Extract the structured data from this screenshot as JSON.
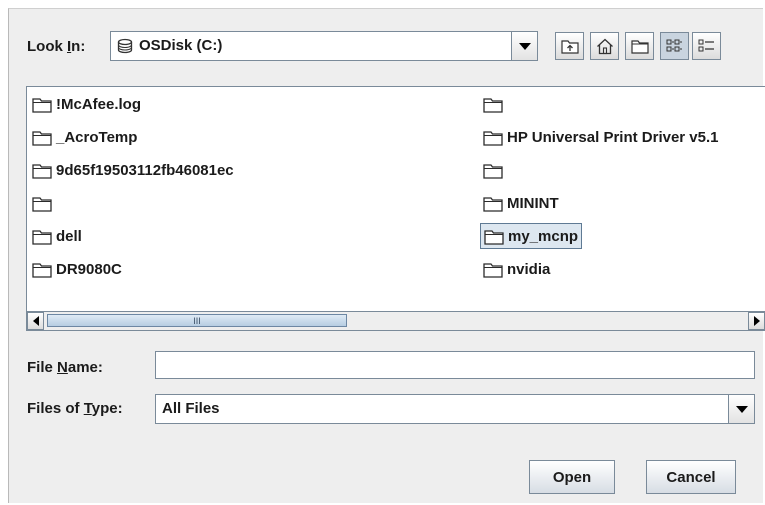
{
  "look_in": {
    "label_pre": "Look ",
    "label_mnemonic": "I",
    "label_post": "n:",
    "value": "OSDisk (C:)",
    "icon": "drive-icon"
  },
  "toolbar": {
    "up_one_level": "folder-up-icon",
    "home": "home-icon",
    "new_folder": "new-folder-icon",
    "list_view": "list-view-icon",
    "details_view": "details-view-icon"
  },
  "files": {
    "left_column": [
      {
        "name": "!McAfee.log"
      },
      {
        "name": "_AcroTemp"
      },
      {
        "name": "9d65f19503112fb46081ec"
      },
      {
        "name": ""
      },
      {
        "name": "dell"
      },
      {
        "name": "DR9080C"
      }
    ],
    "right_column": [
      {
        "name": ""
      },
      {
        "name": "HP Universal Print Driver v5.1"
      },
      {
        "name": ""
      },
      {
        "name": "MININT"
      },
      {
        "name": "my_mcnp",
        "selected": true
      },
      {
        "name": "nvidia"
      }
    ]
  },
  "scrollbar": {
    "thumb_grip": "III"
  },
  "file_name": {
    "label_pre": "File ",
    "label_mnemonic": "N",
    "label_post": "ame:",
    "value": ""
  },
  "files_of_type": {
    "label_pre": "Files of ",
    "label_mnemonic": "T",
    "label_post": "ype:",
    "value": "All Files"
  },
  "buttons": {
    "open": "Open",
    "cancel": "Cancel"
  },
  "colors": {
    "dialog_bg": "#eeeeee",
    "border": "#7a8a99",
    "selection_bg": "#dde7f0"
  }
}
